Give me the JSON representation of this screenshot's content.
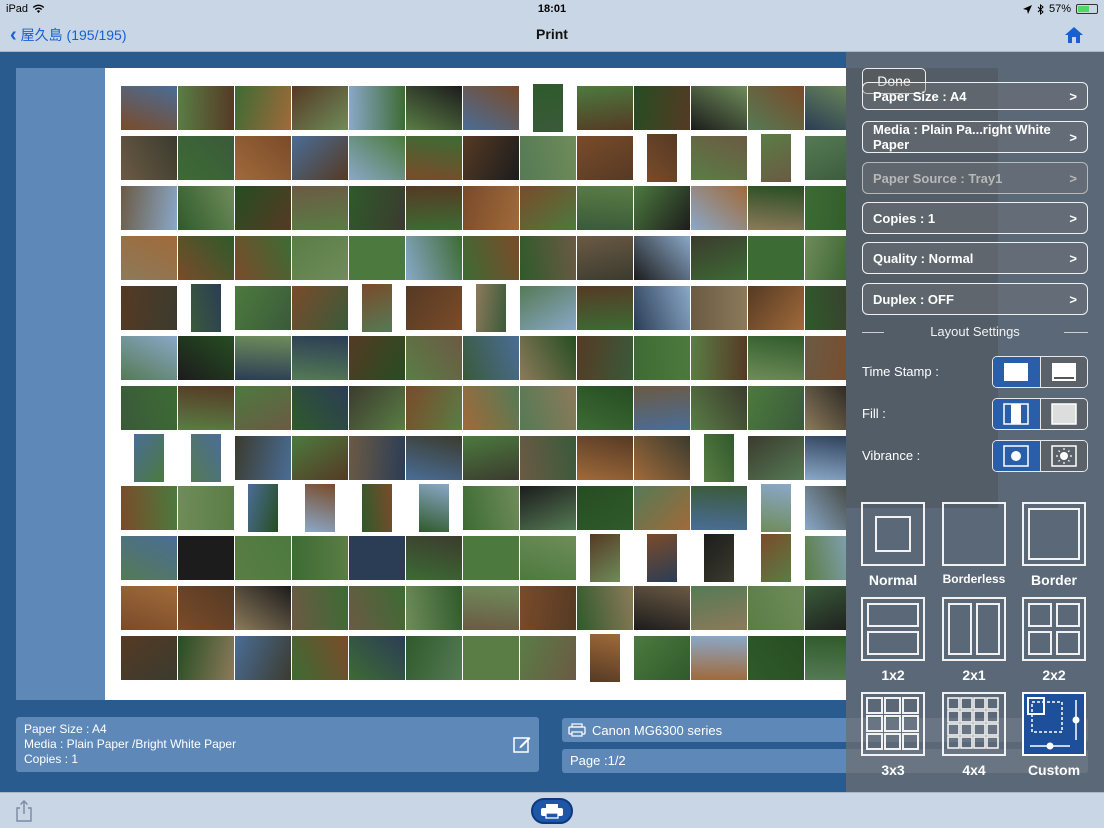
{
  "status": {
    "device": "iPad",
    "time": "18:01",
    "battery": "57%"
  },
  "nav": {
    "back_label": "屋久島 (195/195)",
    "title": "Print"
  },
  "info": {
    "paper_size": "Paper Size : A4",
    "media": "Media : Plain Paper /Bright White Paper",
    "copies": "Copies : 1"
  },
  "printer": {
    "name": "Canon MG6300 series",
    "page": "Page :1/2"
  },
  "settings": {
    "done_label": "Done",
    "rows": [
      {
        "label": "Paper Size : A4",
        "arrow": ">"
      },
      {
        "label": "Media : Plain Pa...right White Paper",
        "arrow": ">"
      },
      {
        "label": "Paper Source : Tray1",
        "arrow": ">"
      },
      {
        "label": "Copies : 1",
        "arrow": ">"
      },
      {
        "label": "Quality : Normal",
        "arrow": ">"
      },
      {
        "label": "Duplex : OFF",
        "arrow": ">"
      }
    ],
    "layout_title": "Layout Settings",
    "time_stamp_label": "Time Stamp :",
    "fill_label": "Fill :",
    "vibrance_label": "Vibrance :",
    "layouts": [
      "Normal",
      "Borderless",
      "Border",
      "1x2",
      "2x1",
      "2x2",
      "3x3",
      "4x4",
      "Custom"
    ],
    "selected_layout": "Custom"
  },
  "colors": {
    "accent": "#1e56a8",
    "nav_bg": "#c9d6e6",
    "app_bg": "#2a5b8f",
    "link": "#1a5fd0"
  }
}
